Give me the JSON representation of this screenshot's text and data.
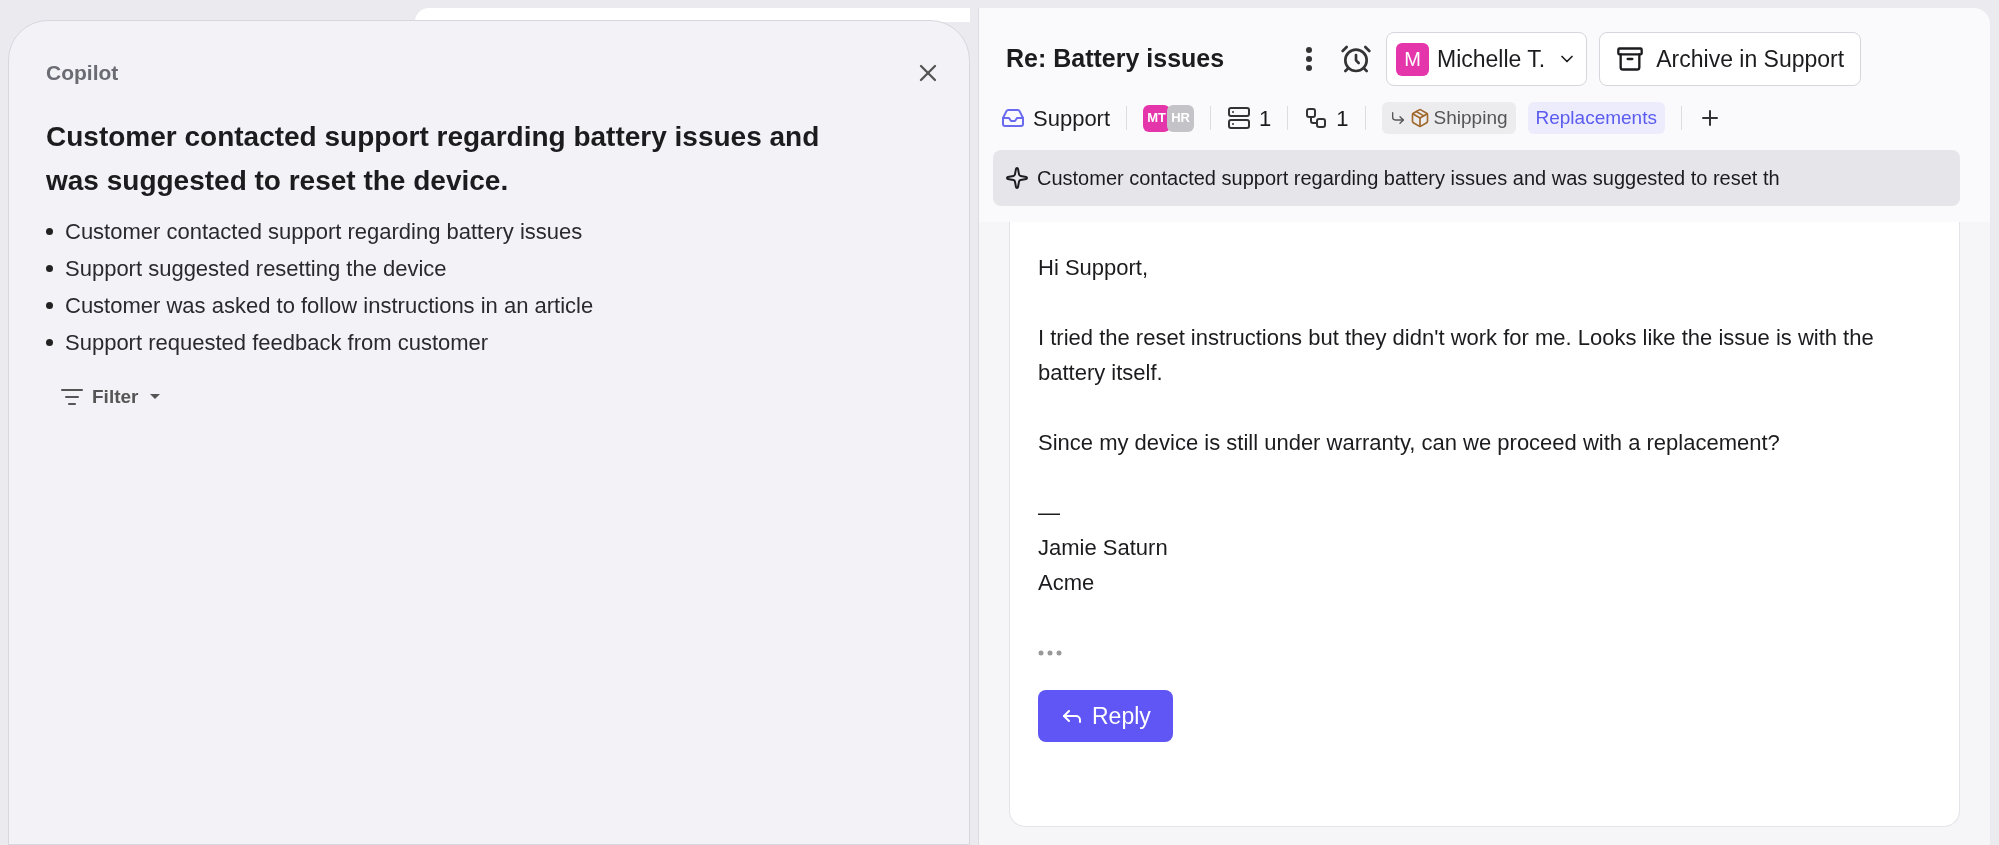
{
  "copilot": {
    "title": "Copilot",
    "summary_heading": "Customer contacted support regarding battery issues and was suggested to reset the device.",
    "bullets": [
      "Customer contacted support regarding battery issues",
      "Support suggested resetting the device",
      "Customer was asked to follow instructions in an article",
      "Support requested feedback from customer"
    ],
    "filter": "Filter"
  },
  "conversation": {
    "subject": "Re: Battery issues",
    "assignee": {
      "initial": "M",
      "name": "Michelle T.",
      "color": "#e535ab"
    },
    "archive_button": "Archive in Support",
    "inbox": "Support",
    "participants": [
      {
        "initials": "MT",
        "color": "#e535ab"
      },
      {
        "initials": "HR",
        "color": "#c4c4c8"
      }
    ],
    "counts": [
      {
        "kind": "tickets",
        "value": "1"
      },
      {
        "kind": "links",
        "value": "1"
      }
    ],
    "tags": [
      {
        "kind": "linked",
        "label": "Shipping"
      },
      {
        "kind": "plain",
        "label": "Replacements"
      }
    ],
    "ai_summary": "Customer contacted support regarding battery issues and was suggested to reset th"
  },
  "message": {
    "paragraphs": [
      "Hi Support,",
      "I tried the reset instructions but they didn't work for me. Looks like the issue is with the battery itself.",
      "Since my device is still under warranty, can we proceed with a replacement?"
    ],
    "signature": [
      "—",
      "Jamie Saturn",
      "Acme"
    ],
    "reply_button": "Reply"
  }
}
